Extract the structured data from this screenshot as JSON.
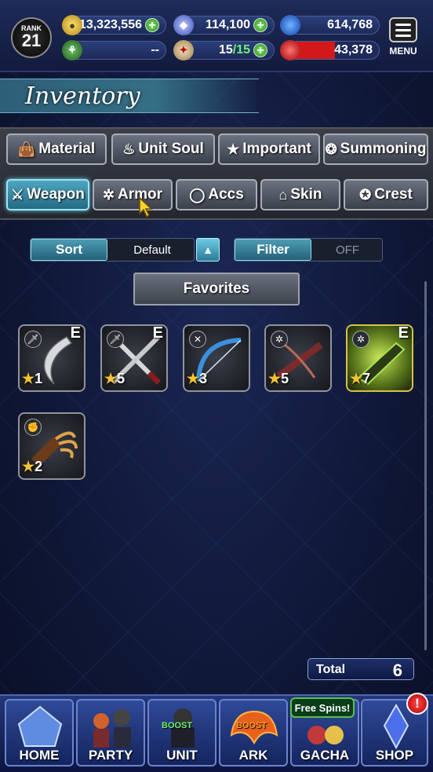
{
  "header": {
    "rank_label": "RANK",
    "rank_value": "21",
    "gil": "13,323,556",
    "crystals": "114,100",
    "blue_orbs": "614,768",
    "guild": "--",
    "stamina": "15",
    "stamina_max": "/15",
    "red_value": "43,378",
    "menu_label": "MENU"
  },
  "banner": {
    "title": "Inventory"
  },
  "categories_row1": [
    {
      "label": "Material",
      "icon": "bag-icon"
    },
    {
      "label": "Unit Soul",
      "icon": "soul-icon"
    },
    {
      "label": "Important",
      "icon": "star-icon"
    },
    {
      "label": "Summoning",
      "icon": "summon-icon"
    }
  ],
  "categories_row2": [
    {
      "label": "Weapon",
      "icon": "sword-icon",
      "active": true
    },
    {
      "label": "Armor",
      "icon": "armor-icon",
      "active": false
    },
    {
      "label": "Accs",
      "icon": "ring-icon",
      "active": false
    },
    {
      "label": "Skin",
      "icon": "hanger-icon",
      "active": false
    },
    {
      "label": "Crest",
      "icon": "crest-icon",
      "active": false
    }
  ],
  "sort": {
    "label": "Sort",
    "value": "Default"
  },
  "filter": {
    "label": "Filter",
    "value": "OFF"
  },
  "favorites_label": "Favorites",
  "items": [
    {
      "stars": "1",
      "equipped": "E"
    },
    {
      "stars": "5",
      "equipped": "E"
    },
    {
      "stars": "3",
      "equipped": ""
    },
    {
      "stars": "5",
      "equipped": ""
    },
    {
      "stars": "7",
      "equipped": "E"
    },
    {
      "stars": "2",
      "equipped": ""
    }
  ],
  "star_glyph": "★",
  "total": {
    "label": "Total",
    "value": "6"
  },
  "nav": {
    "home": "HOME",
    "party": "PARTY",
    "unit": "UNIT",
    "ark": "ARK",
    "gacha": "GACHA",
    "shop": "SHOP",
    "boost": "BOOST",
    "free_spins": "Free Spins!",
    "badge": "!"
  },
  "colors": {
    "accent_active": "#4fa6c0",
    "plus_green": "#2f8c22",
    "gold_frame": "#d8c246"
  }
}
